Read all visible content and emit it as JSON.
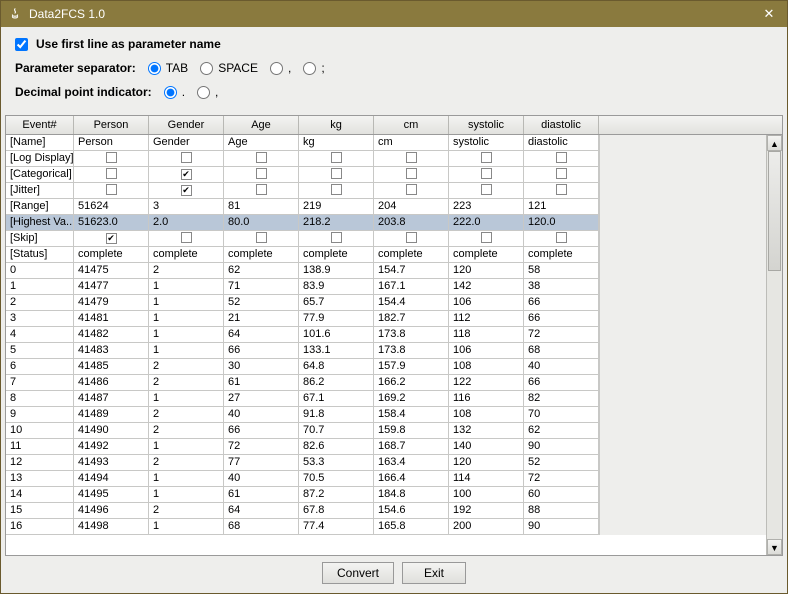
{
  "window": {
    "title": "Data2FCS 1.0"
  },
  "options": {
    "use_first_line_label": "Use first line as parameter name",
    "use_first_line_checked": true,
    "param_sep_label": "Parameter separator:",
    "param_sep": {
      "tab": "TAB",
      "space": "SPACE",
      "comma": ",",
      "semicolon": ";"
    },
    "param_sep_selected": "tab",
    "decimal_label": "Decimal point indicator:",
    "decimal": {
      "dot": ".",
      "comma": ","
    },
    "decimal_selected": "dot"
  },
  "columns": [
    "Event#",
    "Person",
    "Gender",
    "Age",
    "kg",
    "cm",
    "systolic",
    "diastolic"
  ],
  "meta_rows": [
    {
      "label": "[Name]",
      "type": "text",
      "values": [
        "Person",
        "Gender",
        "Age",
        "kg",
        "cm",
        "systolic",
        "diastolic"
      ]
    },
    {
      "label": "[Log Display]",
      "type": "check",
      "values": [
        false,
        false,
        false,
        false,
        false,
        false,
        false
      ]
    },
    {
      "label": "[Categorical]",
      "type": "check",
      "values": [
        false,
        true,
        false,
        false,
        false,
        false,
        false
      ]
    },
    {
      "label": "[Jitter]",
      "type": "check",
      "values": [
        false,
        true,
        false,
        false,
        false,
        false,
        false
      ]
    },
    {
      "label": "[Range]",
      "type": "text",
      "values": [
        "51624",
        "3",
        "81",
        "219",
        "204",
        "223",
        "121"
      ]
    },
    {
      "label": "[Highest Va...",
      "type": "text",
      "highlight": true,
      "values": [
        "51623.0",
        "2.0",
        "80.0",
        "218.2",
        "203.8",
        "222.0",
        "120.0"
      ]
    },
    {
      "label": "[Skip]",
      "type": "check",
      "values": [
        true,
        false,
        false,
        false,
        false,
        false,
        false
      ]
    },
    {
      "label": "[Status]",
      "type": "text",
      "values": [
        "complete",
        "complete",
        "complete",
        "complete",
        "complete",
        "complete",
        "complete"
      ]
    }
  ],
  "data_rows": [
    {
      "event": "0",
      "v": [
        "41475",
        "2",
        "62",
        "138.9",
        "154.7",
        "120",
        "58"
      ]
    },
    {
      "event": "1",
      "v": [
        "41477",
        "1",
        "71",
        "83.9",
        "167.1",
        "142",
        "38"
      ]
    },
    {
      "event": "2",
      "v": [
        "41479",
        "1",
        "52",
        "65.7",
        "154.4",
        "106",
        "66"
      ]
    },
    {
      "event": "3",
      "v": [
        "41481",
        "1",
        "21",
        "77.9",
        "182.7",
        "112",
        "66"
      ]
    },
    {
      "event": "4",
      "v": [
        "41482",
        "1",
        "64",
        "101.6",
        "173.8",
        "118",
        "72"
      ]
    },
    {
      "event": "5",
      "v": [
        "41483",
        "1",
        "66",
        "133.1",
        "173.8",
        "106",
        "68"
      ]
    },
    {
      "event": "6",
      "v": [
        "41485",
        "2",
        "30",
        "64.8",
        "157.9",
        "108",
        "40"
      ]
    },
    {
      "event": "7",
      "v": [
        "41486",
        "2",
        "61",
        "86.2",
        "166.2",
        "122",
        "66"
      ]
    },
    {
      "event": "8",
      "v": [
        "41487",
        "1",
        "27",
        "67.1",
        "169.2",
        "116",
        "82"
      ]
    },
    {
      "event": "9",
      "v": [
        "41489",
        "2",
        "40",
        "91.8",
        "158.4",
        "108",
        "70"
      ]
    },
    {
      "event": "10",
      "v": [
        "41490",
        "2",
        "66",
        "70.7",
        "159.8",
        "132",
        "62"
      ]
    },
    {
      "event": "11",
      "v": [
        "41492",
        "1",
        "72",
        "82.6",
        "168.7",
        "140",
        "90"
      ]
    },
    {
      "event": "12",
      "v": [
        "41493",
        "2",
        "77",
        "53.3",
        "163.4",
        "120",
        "52"
      ]
    },
    {
      "event": "13",
      "v": [
        "41494",
        "1",
        "40",
        "70.5",
        "166.4",
        "114",
        "72"
      ]
    },
    {
      "event": "14",
      "v": [
        "41495",
        "1",
        "61",
        "87.2",
        "184.8",
        "100",
        "60"
      ]
    },
    {
      "event": "15",
      "v": [
        "41496",
        "2",
        "64",
        "67.8",
        "154.6",
        "192",
        "88"
      ]
    },
    {
      "event": "16",
      "v": [
        "41498",
        "1",
        "68",
        "77.4",
        "165.8",
        "200",
        "90"
      ]
    }
  ],
  "buttons": {
    "convert": "Convert",
    "exit": "Exit"
  }
}
